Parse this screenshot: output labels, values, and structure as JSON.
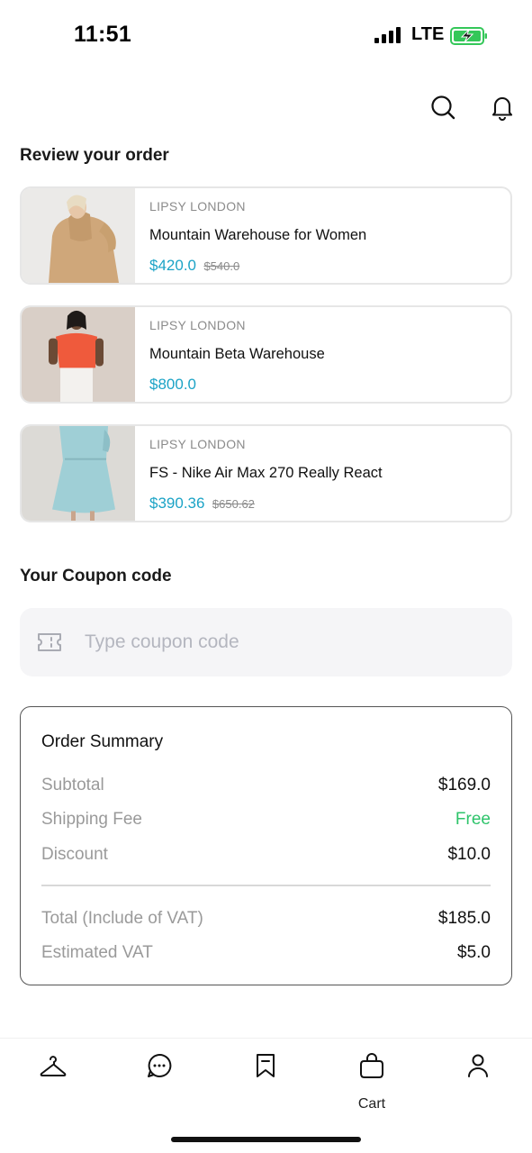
{
  "status_bar": {
    "time": "11:51",
    "network": "LTE"
  },
  "header": {
    "search_icon": "search-icon",
    "notification_icon": "bell-icon"
  },
  "review": {
    "title": "Review your order",
    "items": [
      {
        "brand": "LIPSY LONDON",
        "name": "Mountain Warehouse for Women",
        "price": "$420.0",
        "old_price": "$540.0"
      },
      {
        "brand": "LIPSY LONDON",
        "name": "Mountain Beta Warehouse",
        "price": "$800.0",
        "old_price": ""
      },
      {
        "brand": "LIPSY LONDON",
        "name": "FS - Nike Air Max 270 Really React",
        "price": "$390.36",
        "old_price": "$650.62"
      }
    ]
  },
  "coupon": {
    "title": "Your Coupon code",
    "placeholder": "Type coupon code",
    "value": "",
    "icon": "ticket-icon"
  },
  "summary": {
    "title": "Order Summary",
    "subtotal": {
      "label": "Subtotal",
      "value": "$169.0"
    },
    "shipping": {
      "label": "Shipping Fee",
      "value": "Free"
    },
    "discount": {
      "label": "Discount",
      "value": "$10.0"
    },
    "total": {
      "label": "Total (Include of VAT)",
      "value": "$185.0"
    },
    "vat": {
      "label": "Estimated VAT",
      "value": "$5.0"
    }
  },
  "nav": {
    "items": [
      {
        "icon": "hanger-icon",
        "label": ""
      },
      {
        "icon": "chat-icon",
        "label": ""
      },
      {
        "icon": "bookmark-icon",
        "label": ""
      },
      {
        "icon": "bag-icon",
        "label": "Cart"
      },
      {
        "icon": "profile-icon",
        "label": ""
      }
    ]
  },
  "colors": {
    "price": "#1ba3c6",
    "free": "#2ec46b",
    "battery": "#34c759"
  }
}
